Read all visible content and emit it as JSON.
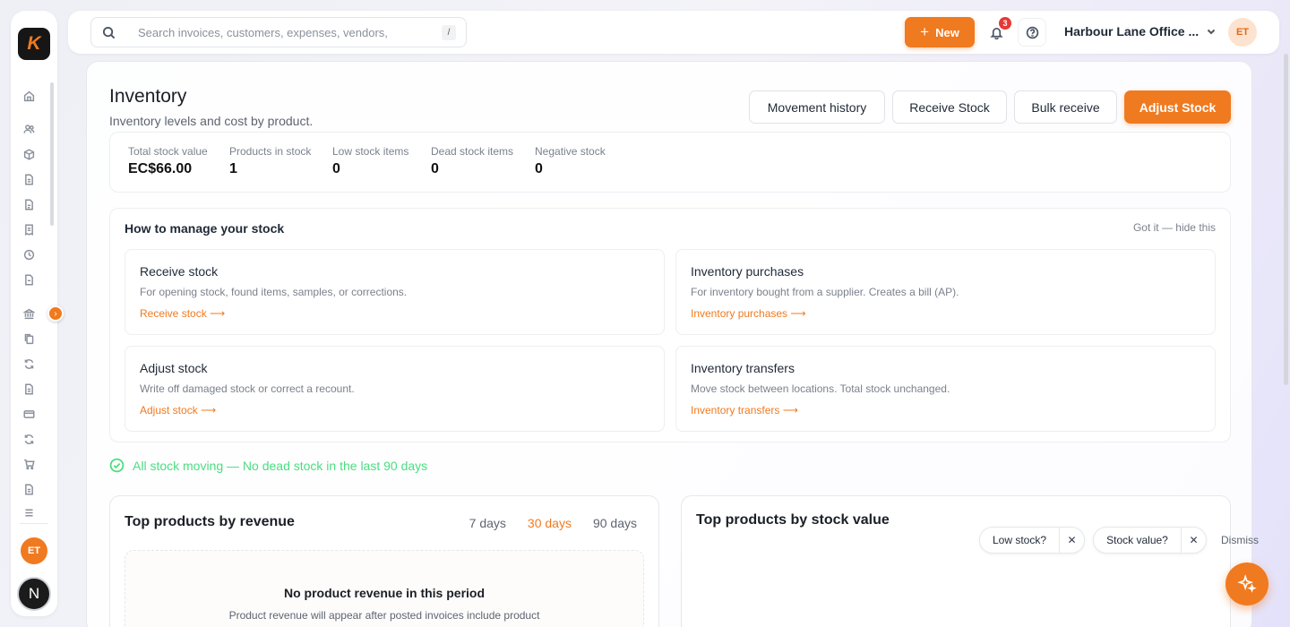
{
  "app": {
    "logo_letter": "K",
    "accent_color": "#f07a1f"
  },
  "sidebar": {
    "icons": [
      "home-icon",
      "users-icon",
      "box-icon",
      "document-icon",
      "invoice-icon",
      "receipt-icon",
      "clock-icon",
      "file-icon",
      "bank-icon",
      "copy-icon",
      "refresh-icon",
      "bill-icon",
      "credit-card-icon",
      "sync-icon",
      "cart-icon",
      "report-icon"
    ],
    "user_initials": "ET",
    "bottom_letter": "N"
  },
  "topbar": {
    "search_placeholder": "Search invoices, customers, expenses, vendors,",
    "search_shortcut": "/",
    "new_label": "New",
    "notification_count": "3",
    "org_name": "Harbour Lane Office ...",
    "user_initials": "ET"
  },
  "page": {
    "title": "Inventory",
    "subtitle": "Inventory levels and cost by product.",
    "actions": {
      "movement_history": "Movement history",
      "receive_stock": "Receive Stock",
      "bulk_receive": "Bulk receive",
      "adjust_stock": "Adjust Stock"
    }
  },
  "stats": [
    {
      "label": "Total stock value",
      "value": "EC$66.00"
    },
    {
      "label": "Products in stock",
      "value": "1"
    },
    {
      "label": "Low stock items",
      "value": "0"
    },
    {
      "label": "Dead stock items",
      "value": "0"
    },
    {
      "label": "Negative stock",
      "value": "0"
    }
  ],
  "howto": {
    "title": "How to manage your stock",
    "hide_label": "Got it — hide this",
    "cards": [
      {
        "title": "Receive stock",
        "desc": "For opening stock, found items, samples, or corrections.",
        "link": "Receive stock ⟶"
      },
      {
        "title": "Inventory purchases",
        "desc": "For inventory bought from a supplier. Creates a bill (AP).",
        "link": "Inventory purchases ⟶"
      },
      {
        "title": "Adjust stock",
        "desc": "Write off damaged stock or correct a recount.",
        "link": "Adjust stock ⟶"
      },
      {
        "title": "Inventory transfers",
        "desc": "Move stock between locations. Total stock unchanged.",
        "link": "Inventory transfers ⟶"
      }
    ]
  },
  "status_line": "All stock moving — No dead stock in the last 90 days",
  "revenue_panel": {
    "title": "Top products by revenue",
    "tabs": [
      "7 days",
      "30 days",
      "90 days"
    ],
    "active_tab": "30 days",
    "empty_title": "No product revenue in this period",
    "empty_desc": "Product revenue will appear after posted invoices include product"
  },
  "stock_value_panel": {
    "title": "Top products by stock value"
  },
  "chips": [
    {
      "label": "Low stock?"
    },
    {
      "label": "Stock value?"
    }
  ],
  "dismiss_label": "Dismiss"
}
